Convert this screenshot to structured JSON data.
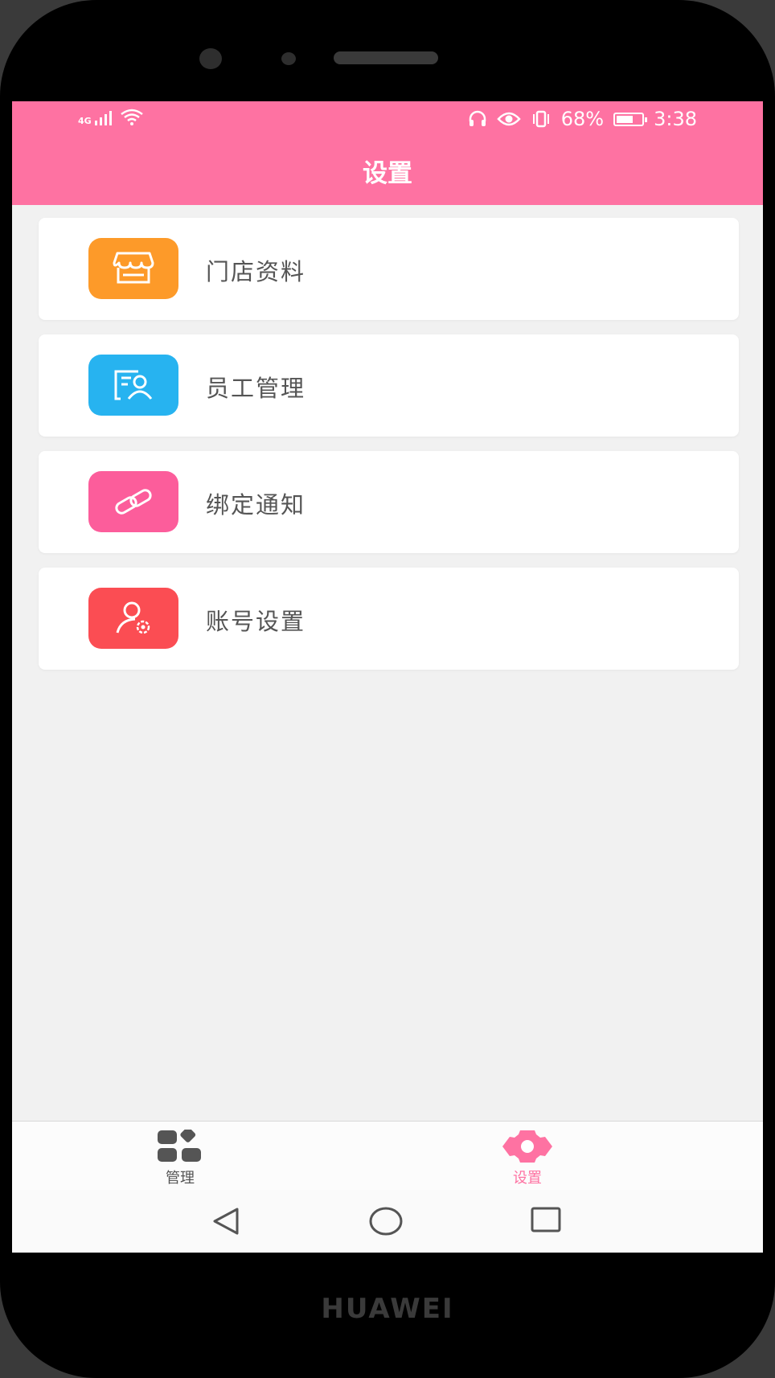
{
  "status_bar": {
    "network": "4G",
    "battery": "68%",
    "battery_level": 0.68,
    "time": "3:38",
    "icons": [
      "signal-icon",
      "wifi-icon",
      "headset-icon",
      "eye-icon",
      "vibrate-icon",
      "battery-icon"
    ]
  },
  "header": {
    "title": "设置"
  },
  "menu": {
    "items": [
      {
        "label": "门店资料",
        "icon": "store-icon",
        "color": "#fd9a29"
      },
      {
        "label": "员工管理",
        "icon": "staff-card-icon",
        "color": "#27b3f0"
      },
      {
        "label": "绑定通知",
        "icon": "link-icon",
        "color": "#fc5d9b"
      },
      {
        "label": "账号设置",
        "icon": "user-settings-icon",
        "color": "#fb4d53"
      }
    ]
  },
  "tabbar": {
    "tabs": [
      {
        "label": "管理",
        "icon": "grid-apps-icon",
        "active": false
      },
      {
        "label": "设置",
        "icon": "gear-icon",
        "active": true
      }
    ]
  },
  "device": {
    "brand": "HUAWEI"
  },
  "colors": {
    "accent": "#fe72a2",
    "background": "#f1f1f1",
    "inactive": "#555555"
  }
}
